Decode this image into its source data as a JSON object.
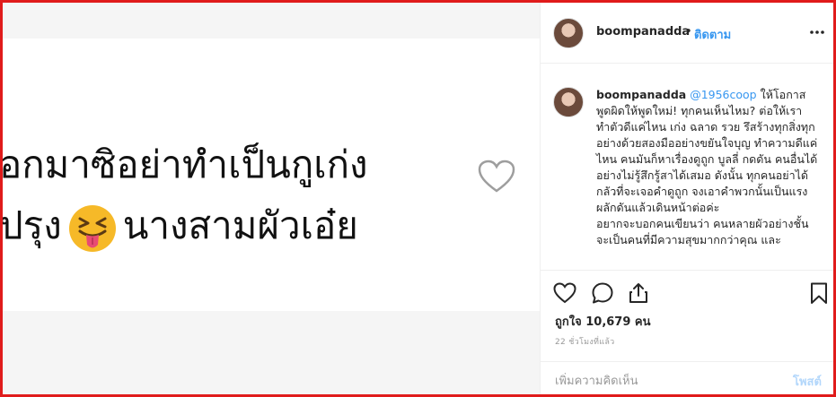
{
  "post_image": {
    "line1": "อกมาซิอย่าทำเป็นกูเก่ง",
    "line2_before": "ปรุง",
    "line2_after": "นางสามผัวเอ๋ย",
    "emoji_icon": "squinting-face-with-tongue-icon"
  },
  "header": {
    "username": "boompanadda",
    "separator": "•",
    "follow_label": "ติดตาม",
    "more_icon": "more-options-icon"
  },
  "caption": {
    "username": "boompanadda",
    "mention": "@1956coop",
    "text": "ให้โอกาส พูดผิดให้พูดใหม่! ทุกคนเห็นไหม? ต่อให้เราทำตัวดีแค่ไหน เก่ง ฉลาด รวย รึสร้างทุกสิ่งทุกอย่างด้วยสองมืออย่างขยันใจบุญ ทำความดีแค่ไหน คนมันก็หาเรื่องดูถูก บูลลี่ กดดัน คนอื่นได้อย่างไม่รู้สึกรู้สาได้เสมอ ดังนั้น ทุกคนอย่าได้กลัวที่จะเจอคำดูถูก จงเอาคำพวกนั้นเป็นแรงผลักดันแล้วเดินหน้าต่อค่ะ\nอยากจะบอกคนเขียนว่า คนหลายผัวอย่างชั้น จะเป็นคนที่มีความสุขมากกว่าคุณ และ"
  },
  "actions": {
    "likes": "ถูกใจ 10,679 คน",
    "timestamp": "22 ชั่วโมงที่แล้ว"
  },
  "comment": {
    "placeholder": "เพิ่มความคิดเห็น",
    "post_label": "โพสต์"
  },
  "colors": {
    "frame": "#e01b1b",
    "link": "#3897f0",
    "post_disabled": "#b3d7fb"
  }
}
